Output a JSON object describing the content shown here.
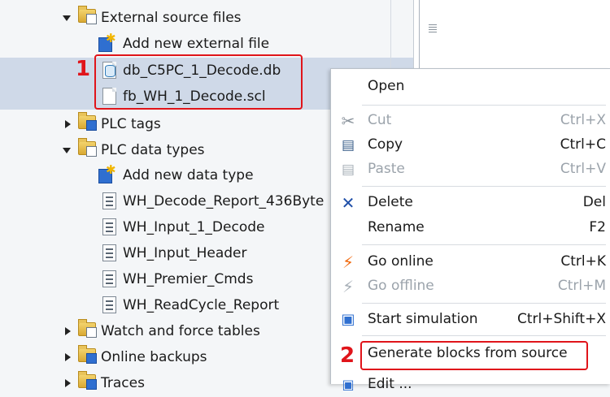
{
  "tree": {
    "items": [
      {
        "label": "External source files",
        "icon": "external-sources-folder-icon",
        "expander": "expanded"
      },
      {
        "label": "Add new external file",
        "icon": "add-new-icon"
      },
      {
        "label": "db_C5PC_1_Decode.db",
        "icon": "db-file-icon",
        "selected": true
      },
      {
        "label": "fb_WH_1_Decode.scl",
        "icon": "scl-file-icon",
        "selected": true
      },
      {
        "label": "PLC tags",
        "icon": "plc-tags-folder-icon",
        "expander": "collapsed"
      },
      {
        "label": "PLC data types",
        "icon": "data-types-folder-icon",
        "expander": "expanded"
      },
      {
        "label": "Add new data type",
        "icon": "add-new-icon"
      },
      {
        "label": "WH_Decode_Report_436Byte",
        "icon": "data-type-icon"
      },
      {
        "label": "WH_Input_1_Decode",
        "icon": "data-type-icon"
      },
      {
        "label": "WH_Input_Header",
        "icon": "data-type-icon"
      },
      {
        "label": "WH_Premier_Cmds",
        "icon": "data-type-icon"
      },
      {
        "label": "WH_ReadCycle_Report",
        "icon": "data-type-icon"
      },
      {
        "label": "Watch and force tables",
        "icon": "watch-tables-folder-icon",
        "expander": "collapsed"
      },
      {
        "label": "Online backups",
        "icon": "online-backups-folder-icon",
        "expander": "collapsed"
      },
      {
        "label": "Traces",
        "icon": "traces-folder-icon",
        "expander": "collapsed"
      }
    ]
  },
  "context_menu": {
    "items": [
      {
        "label": "Open",
        "shortcut": "",
        "icon": "",
        "enabled": true
      },
      {
        "label": "Cut",
        "shortcut": "Ctrl+X",
        "icon": "scissors-icon",
        "enabled": false
      },
      {
        "label": "Copy",
        "shortcut": "Ctrl+C",
        "icon": "copy-icon",
        "enabled": true
      },
      {
        "label": "Paste",
        "shortcut": "Ctrl+V",
        "icon": "paste-icon",
        "enabled": false
      },
      {
        "label": "Delete",
        "shortcut": "Del",
        "icon": "delete-x-icon",
        "enabled": true
      },
      {
        "label": "Rename",
        "shortcut": "F2",
        "icon": "",
        "enabled": true
      },
      {
        "label": "Go online",
        "shortcut": "Ctrl+K",
        "icon": "go-online-icon",
        "enabled": true
      },
      {
        "label": "Go offline",
        "shortcut": "Ctrl+M",
        "icon": "go-offline-icon",
        "enabled": false
      },
      {
        "label": "Start simulation",
        "shortcut": "Ctrl+Shift+X",
        "icon": "simulation-monitor-icon",
        "enabled": true
      },
      {
        "label": "Generate blocks from source",
        "shortcut": "",
        "icon": "",
        "enabled": true
      },
      {
        "label": "Edit ...",
        "shortcut": "",
        "icon": "edit-icon",
        "enabled": true
      }
    ]
  },
  "annotations": {
    "callout_1": "1",
    "callout_2": "2",
    "color": "#e0141a"
  },
  "colors": {
    "selection": "#cfd9e8",
    "panel_bg": "#f4f6f8",
    "delete_icon": "#1f4fa8"
  }
}
